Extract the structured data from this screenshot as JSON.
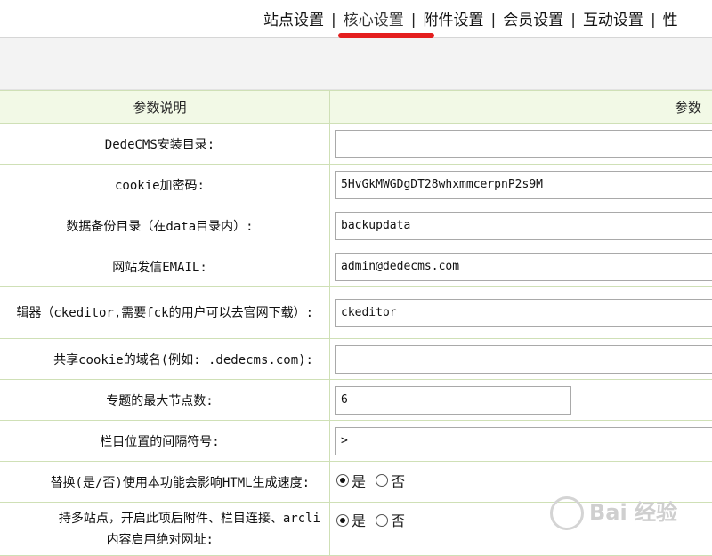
{
  "tabs": [
    {
      "label": "站点设置"
    },
    {
      "label": "核心设置"
    },
    {
      "label": "附件设置"
    },
    {
      "label": "会员设置"
    },
    {
      "label": "互动设置"
    },
    {
      "label": "性"
    }
  ],
  "table": {
    "header_left": "参数说明",
    "header_right": "参数",
    "rows": [
      {
        "label": "DedeCMS安装目录:",
        "value": ""
      },
      {
        "label": "cookie加密码:",
        "value": "5HvGkMWGDgDT28whxmmcerpnP2s9M"
      },
      {
        "label": "数据备份目录（在data目录内）:",
        "value": "backupdata"
      },
      {
        "label": "网站发信EMAIL:",
        "value": "admin@dedecms.com"
      },
      {
        "label": "辑器（ckeditor,需要fck的用户可以去官网下载）:",
        "value": "ckeditor"
      },
      {
        "label": "共享cookie的域名(例如: .dedecms.com):",
        "value": ""
      },
      {
        "label": "专题的最大节点数:",
        "value": "6"
      },
      {
        "label": "栏目位置的间隔符号:",
        "value": ">"
      },
      {
        "label": "替换(是/否)使用本功能会影响HTML生成速度:",
        "yes": "是",
        "no": "否"
      },
      {
        "label": "持多站点，开启此项后附件、栏目连接、arcli",
        "label2": "内容启用绝对网址:",
        "yes": "是",
        "no": "否"
      }
    ]
  },
  "watermark": "Bai 经验"
}
